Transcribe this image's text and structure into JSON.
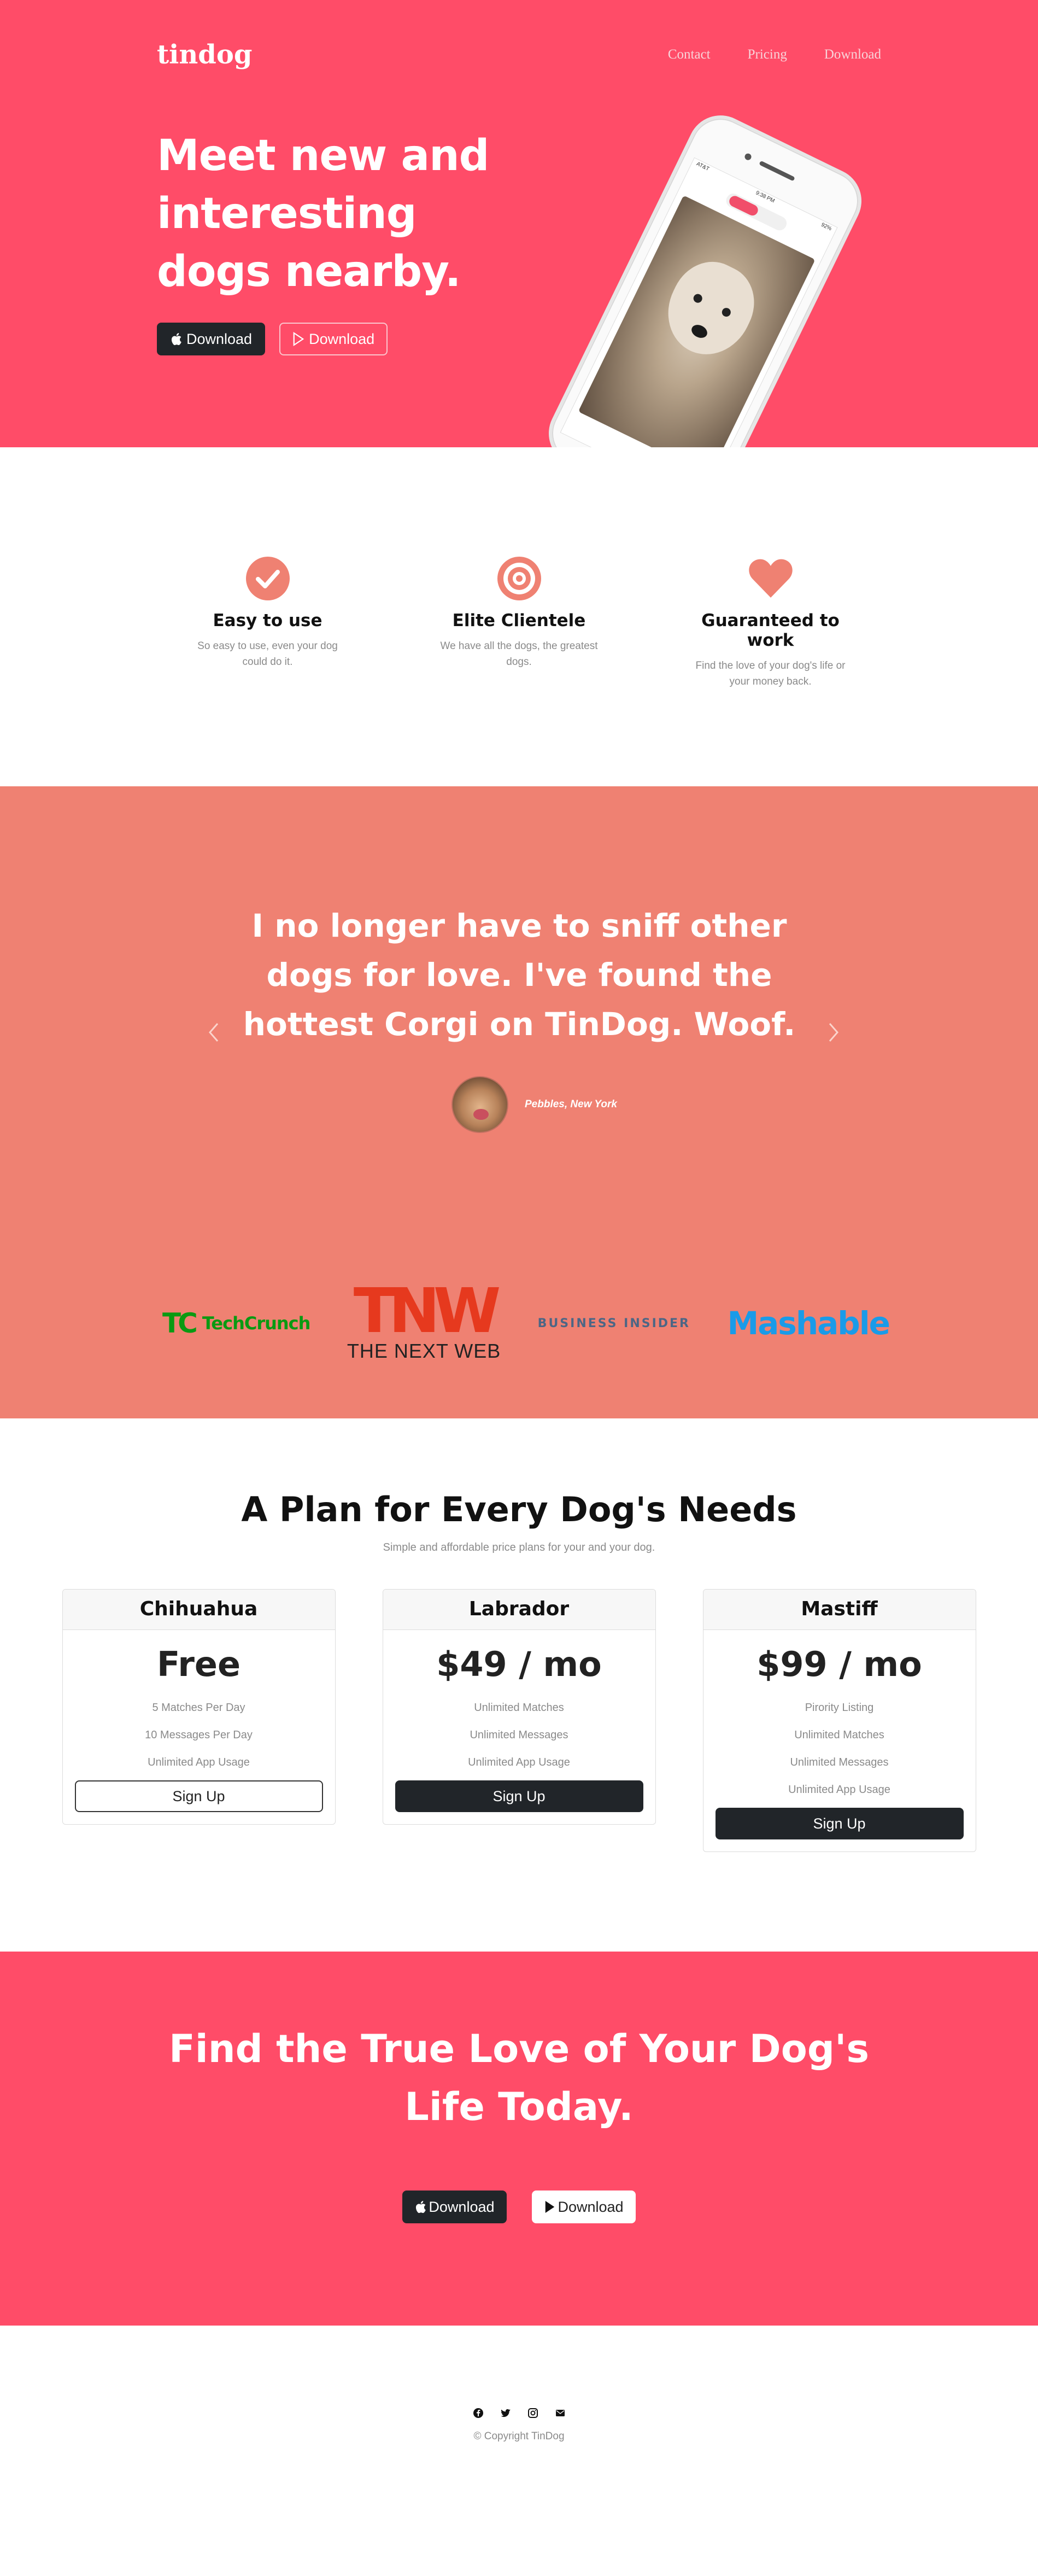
{
  "nav": {
    "brand": "tindog",
    "links": [
      "Contact",
      "Pricing",
      "Download"
    ]
  },
  "hero": {
    "title": "Meet new and interesting dogs nearby.",
    "apple_button": "Download",
    "play_button": "Download",
    "phone_status": {
      "carrier": "AT&T",
      "time": "9:38 PM",
      "battery": "92%"
    }
  },
  "features": [
    {
      "icon": "check-circle-icon",
      "title": "Easy to use",
      "text": "So easy to use, even your dog could do it."
    },
    {
      "icon": "bullseye-icon",
      "title": "Elite Clientele",
      "text": "We have all the dogs, the greatest dogs."
    },
    {
      "icon": "heart-icon",
      "title": "Guaranteed to work",
      "text": "Find the love of your dog's life or your money back."
    }
  ],
  "testimonial": {
    "quote": "I no longer have to sniff other dogs for love. I've found the hottest Corgi on TinDog. Woof.",
    "author": "Pebbles, New York"
  },
  "press": {
    "techcrunch_mark": "TC",
    "techcrunch": "TechCrunch",
    "tnw_mark": "TNW",
    "tnw": "THE NEXT WEB",
    "business_insider": "BUSINESS INSIDER",
    "mashable": "Mashable"
  },
  "pricing": {
    "title": "A Plan for Every Dog's Needs",
    "subtitle": "Simple and affordable price plans for your and your dog.",
    "plans": [
      {
        "name": "Chihuahua",
        "price": "Free",
        "features": [
          "5 Matches Per Day",
          "10 Messages Per Day",
          "Unlimited App Usage"
        ],
        "button": "Sign Up"
      },
      {
        "name": "Labrador",
        "price": "$49 / mo",
        "features": [
          "Unlimited Matches",
          "Unlimited Messages",
          "Unlimited App Usage"
        ],
        "button": "Sign Up"
      },
      {
        "name": "Mastiff",
        "price": "$99 / mo",
        "features": [
          "Pirority Listing",
          "Unlimited Matches",
          "Unlimited Messages",
          "Unlimited App Usage"
        ],
        "button": "Sign Up"
      }
    ]
  },
  "cta": {
    "title": "Find the True Love of Your Dog's Life Today.",
    "apple_button": "Download",
    "play_button": "Download"
  },
  "footer": {
    "socials": [
      "facebook-icon",
      "twitter-icon",
      "instagram-icon",
      "envelope-icon"
    ],
    "copyright": "© Copyright TinDog"
  },
  "colors": {
    "primary": "#ff4c68",
    "secondary": "#ef8172",
    "dark": "#212529"
  }
}
